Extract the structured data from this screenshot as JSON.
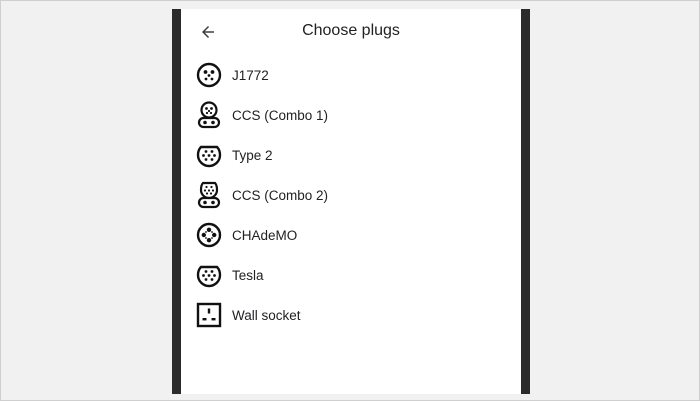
{
  "header": {
    "back_icon": "arrow-back-icon",
    "title": "Choose plugs"
  },
  "plugs": [
    {
      "label": "J1772",
      "icon": "j1772-plug-icon"
    },
    {
      "label": "CCS (Combo 1)",
      "icon": "ccs-combo1-plug-icon"
    },
    {
      "label": "Type 2",
      "icon": "type2-plug-icon"
    },
    {
      "label": "CCS (Combo 2)",
      "icon": "ccs-combo2-plug-icon"
    },
    {
      "label": "CHAdeMO",
      "icon": "chademo-plug-icon"
    },
    {
      "label": "Tesla",
      "icon": "tesla-plug-icon"
    },
    {
      "label": "Wall socket",
      "icon": "wall-socket-icon"
    }
  ],
  "colors": {
    "text": "#202124",
    "frame_border": "#2b2b2b",
    "background": "#f1f1f1"
  }
}
